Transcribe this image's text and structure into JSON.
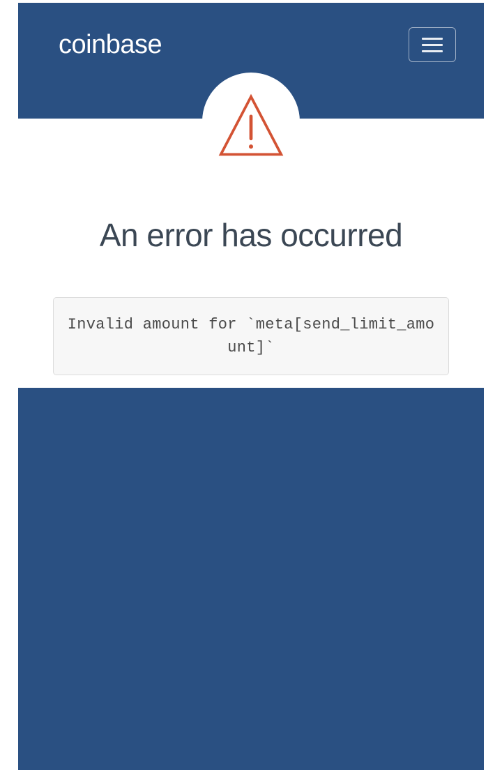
{
  "header": {
    "logo_text": "coinbase"
  },
  "error": {
    "heading": "An error has occurred",
    "message": "Invalid amount for `meta[send_limit_amount]`"
  },
  "colors": {
    "header_bg": "#2a5082",
    "warning": "#d35334",
    "heading_text": "#3b4754"
  },
  "icons": {
    "warning": "warning-triangle-icon",
    "menu": "hamburger-menu-icon"
  }
}
